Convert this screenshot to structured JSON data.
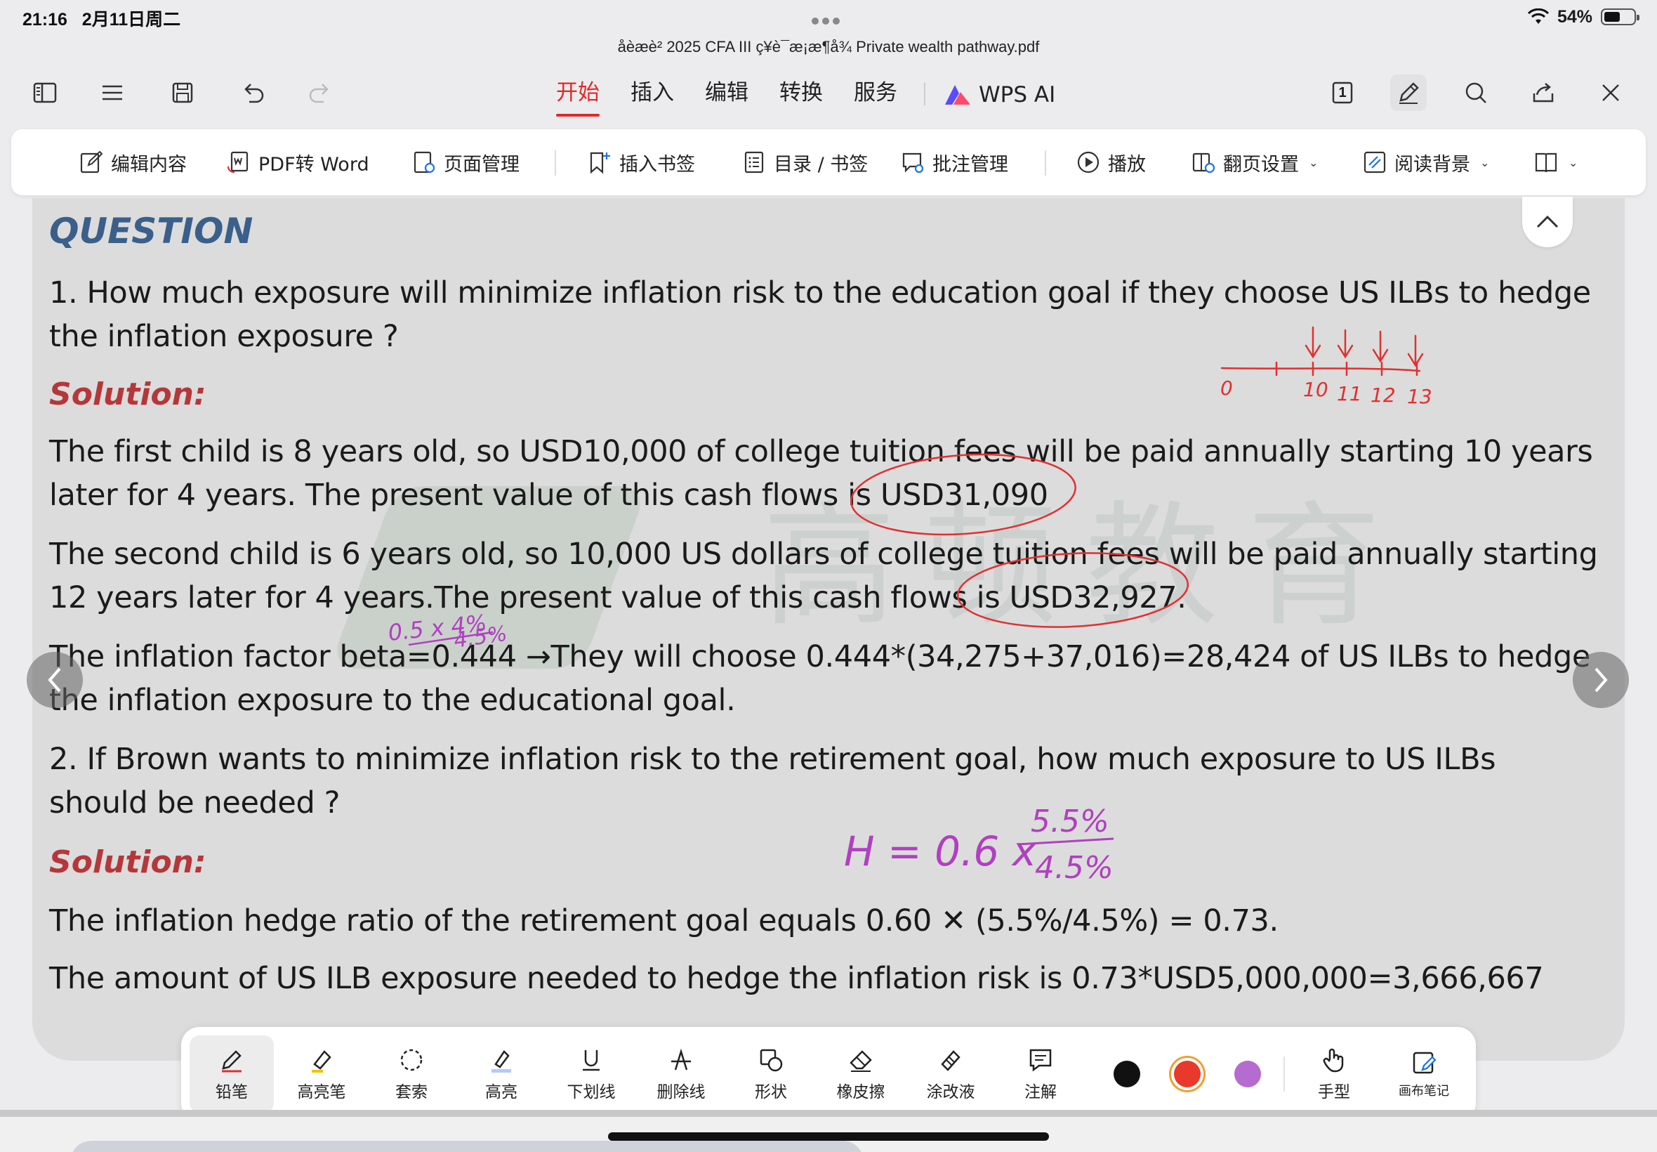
{
  "status": {
    "time": "21:16",
    "date": "2月11日周二",
    "battery": "54%",
    "battery_level": 0.54
  },
  "document": {
    "title": "åèæè² 2025 CFA III ç¥è¯æ¡æ¶å¾ Private wealth pathway.pdf"
  },
  "tabs": [
    {
      "label": "开始",
      "active": true
    },
    {
      "label": "插入"
    },
    {
      "label": "编辑"
    },
    {
      "label": "转换"
    },
    {
      "label": "服务"
    }
  ],
  "wps_ai": "WPS AI",
  "page_indicator": "1",
  "ribbon": {
    "edit_content": "编辑内容",
    "pdf_to_word": "PDF转 Word",
    "page_manage": "页面管理",
    "insert_bookmark": "插入书签",
    "toc_bookmark": "目录 / 书签",
    "comment_manage": "批注管理",
    "play": "播放",
    "page_turn": "翻页设置",
    "read_bg": "阅读背景"
  },
  "content": {
    "question_heading": "QUESTION",
    "q1_line1": "1. How much exposure will minimize inflation risk to the education goal if they choose US ILBs to hedge",
    "q1_line2": "the inflation exposure ?",
    "solution_label": "Solution:",
    "s1_p1_l1": "The first child is 8 years old, so USD10,000 of college tuition fees will be paid annually starting 10 years",
    "s1_p1_l2": "later for 4 years. The present value of this cash flows is USD31,090",
    "s1_p2_l1": "The second child is 6 years old, so 10,000 US dollars of college tuition fees will be paid annually starting",
    "s1_p2_l2": "12 years later for 4 years.The present value of this cash flows is USD32,927.",
    "s1_p3_l1": "The inflation factor beta=0.444 →They will choose 0.444*(34,275+37,016)=28,424 of US ILBs to hedge",
    "s1_p3_l2": "the inflation exposure to the educational goal.",
    "q2_line1": "2. If Brown wants to minimize inflation risk to the retirement goal, how much exposure to US ILBs",
    "q2_line2": "should be needed ?",
    "s2_p1": "The inflation hedge ratio of the retirement goal equals 0.60 ✕ (5.5%/4.5%) = 0.73.",
    "s2_p2": "The amount of US ILB exposure needed to hedge the inflation risk is 0.73*USD5,000,000=3,666,667"
  },
  "annotations": {
    "timeline_labels": [
      "0",
      "10",
      "11",
      "12",
      "13"
    ],
    "beta_note_top": "0.5 x 4%",
    "beta_note_bottom": "4.5%",
    "h_formula": "H = 0.6 x",
    "h_num": "5.5%",
    "h_den": "4.5%"
  },
  "tools": [
    {
      "label": "铅笔",
      "icon": "pencil-icon",
      "active": true
    },
    {
      "label": "高亮笔",
      "icon": "highlighter-pen-icon"
    },
    {
      "label": "套索",
      "icon": "lasso-icon"
    },
    {
      "label": "高亮",
      "icon": "highlight-icon"
    },
    {
      "label": "下划线",
      "icon": "underline-icon"
    },
    {
      "label": "删除线",
      "icon": "strikethrough-icon"
    },
    {
      "label": "形状",
      "icon": "shape-icon"
    },
    {
      "label": "橡皮擦",
      "icon": "eraser-icon"
    },
    {
      "label": "涂改液",
      "icon": "correction-fluid-icon"
    },
    {
      "label": "注解",
      "icon": "note-icon"
    }
  ],
  "colors": {
    "black": "#111111",
    "red": "#e8392b",
    "purple": "#b66bd0",
    "accent": "#e02a2a",
    "annotation_red": "#e03030",
    "annotation_purple": "#b040c0"
  },
  "tools_right": {
    "hand": "手型",
    "canvas_note": "画布笔记"
  }
}
